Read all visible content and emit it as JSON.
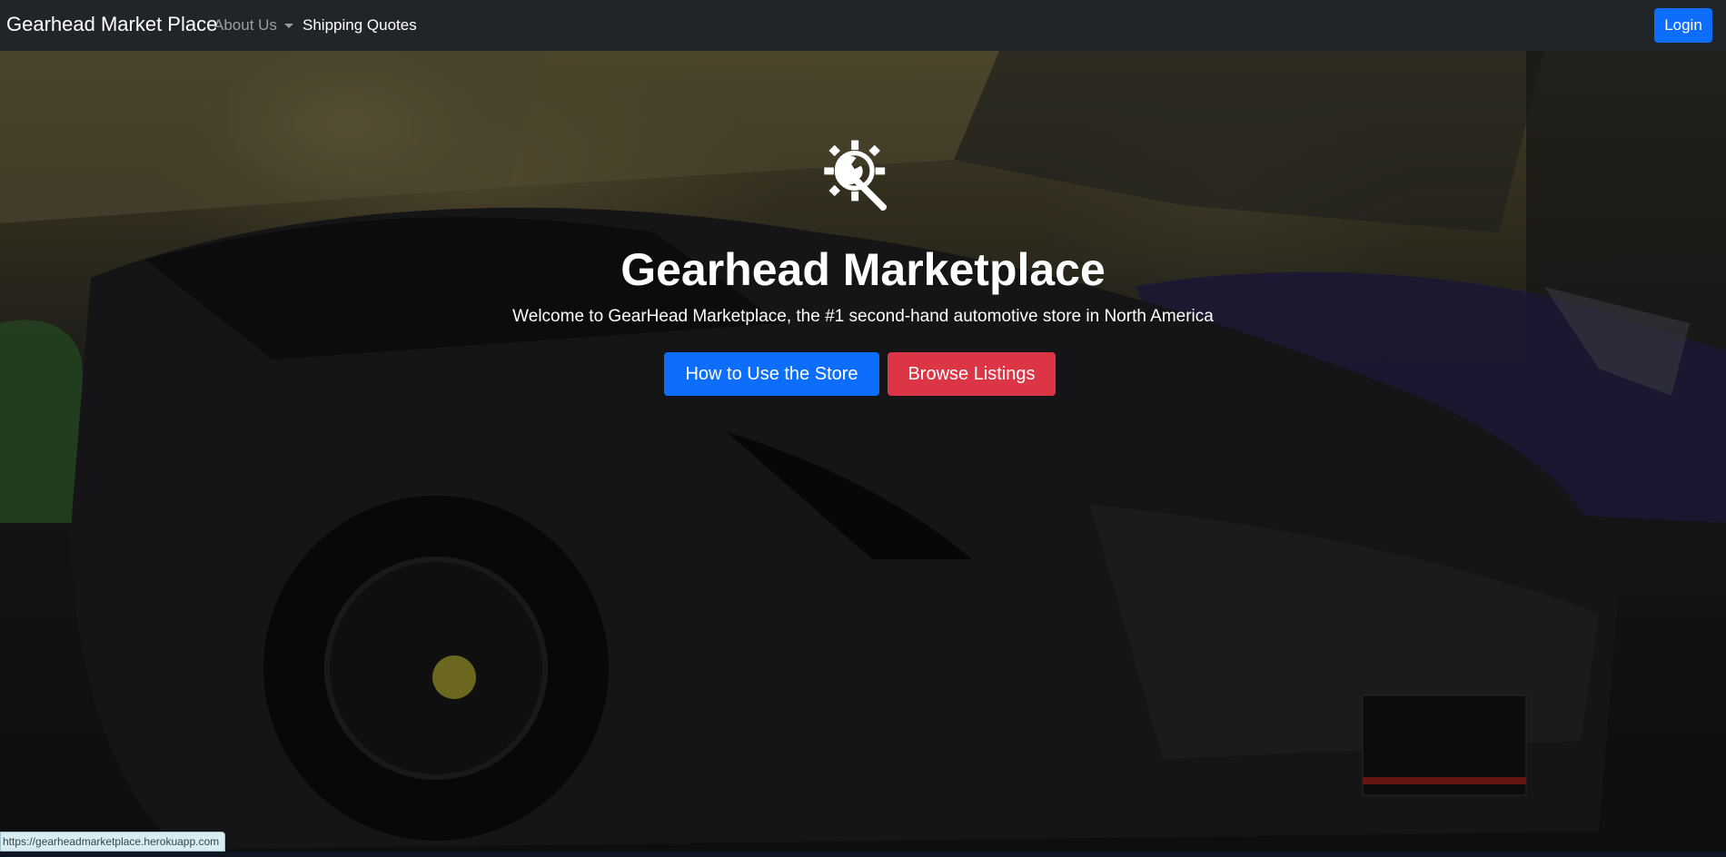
{
  "navbar": {
    "brand": "Gearhead Market Place",
    "about_label": "About Us",
    "shipping_label": "Shipping Quotes",
    "login_label": "Login"
  },
  "hero": {
    "title": "Gearhead Marketplace",
    "subtitle": "Welcome to GearHead Marketplace, the #1 second-hand automotive store in North America",
    "primary_button": "How to Use the Store",
    "secondary_button": "Browse Listings",
    "logo_icon": "gear-wrench-icon"
  },
  "status_bar": {
    "url": "https://gearheadmarketplace.herokuapp.com"
  },
  "colors": {
    "navbar_bg": "#212529",
    "primary": "#0d6efd",
    "danger": "#dc3545"
  }
}
